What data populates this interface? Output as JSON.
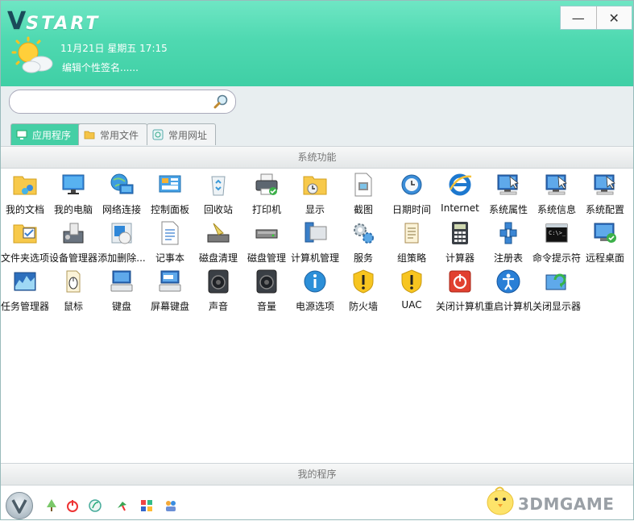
{
  "app": {
    "logo_v": "V",
    "logo_text": "START"
  },
  "window_buttons": {
    "minimize": "—",
    "close": "✕"
  },
  "header": {
    "datetime": "11月21日  星期五  17:15",
    "signature": "编辑个性签名......"
  },
  "search": {
    "value": "",
    "placeholder": ""
  },
  "tabs": [
    {
      "label": "应用程序",
      "icon": "monitor-icon",
      "active": true
    },
    {
      "label": "常用文件",
      "icon": "folder-icon",
      "active": false
    },
    {
      "label": "常用网址",
      "icon": "web-icon",
      "active": false
    }
  ],
  "sections": {
    "system": "系统功能",
    "my_programs": "我的程序"
  },
  "items": [
    {
      "label": "我的文档",
      "icon": "documents-folder-icon"
    },
    {
      "label": "我的电脑",
      "icon": "computer-icon"
    },
    {
      "label": "网络连接",
      "icon": "network-globe-icon"
    },
    {
      "label": "控制面板",
      "icon": "control-panel-icon"
    },
    {
      "label": "回收站",
      "icon": "recycle-bin-icon"
    },
    {
      "label": "打印机",
      "icon": "printer-icon"
    },
    {
      "label": "显示",
      "icon": "display-folder-icon"
    },
    {
      "label": "截图",
      "icon": "screenshot-icon"
    },
    {
      "label": "日期时间",
      "icon": "clock-globe-icon"
    },
    {
      "label": "Internet",
      "icon": "internet-explorer-icon"
    },
    {
      "label": "系统属性",
      "icon": "system-monitor-icon"
    },
    {
      "label": "系统信息",
      "icon": "system-monitor-icon"
    },
    {
      "label": "系统配置",
      "icon": "system-monitor-icon"
    },
    {
      "label": "文件夹选项",
      "icon": "folder-options-icon"
    },
    {
      "label": "设备管理器",
      "icon": "device-manager-icon"
    },
    {
      "label": "添加删除...",
      "icon": "add-remove-icon"
    },
    {
      "label": "记事本",
      "icon": "notepad-icon"
    },
    {
      "label": "磁盘清理",
      "icon": "disk-cleanup-icon"
    },
    {
      "label": "磁盘管理",
      "icon": "disk-icon"
    },
    {
      "label": "计算机管理",
      "icon": "computer-management-icon"
    },
    {
      "label": "服务",
      "icon": "gears-icon"
    },
    {
      "label": "组策略",
      "icon": "scroll-icon"
    },
    {
      "label": "计算器",
      "icon": "calculator-icon"
    },
    {
      "label": "注册表",
      "icon": "registry-cubes-icon"
    },
    {
      "label": "命令提示符",
      "icon": "cmd-icon"
    },
    {
      "label": "远程桌面",
      "icon": "remote-desktop-icon"
    },
    {
      "label": "任务管理器",
      "icon": "task-manager-icon"
    },
    {
      "label": "鼠标",
      "icon": "mouse-icon"
    },
    {
      "label": "键盘",
      "icon": "keyboard-icon"
    },
    {
      "label": "屏幕键盘",
      "icon": "onscreen-keyboard-icon"
    },
    {
      "label": "声音",
      "icon": "speaker-icon"
    },
    {
      "label": "音量",
      "icon": "speaker-icon"
    },
    {
      "label": "电源选项",
      "icon": "power-info-icon"
    },
    {
      "label": "防火墙",
      "icon": "shield-warning-icon"
    },
    {
      "label": "UAC",
      "icon": "shield-warning-icon"
    },
    {
      "label": "关闭计算机",
      "icon": "shutdown-icon"
    },
    {
      "label": "重启计算机",
      "icon": "accessibility-icon"
    },
    {
      "label": "关闭显示器",
      "icon": "display-refresh-icon"
    }
  ],
  "quick_icons": [
    "tree-icon",
    "power-icon",
    "leaf-icon",
    "bird-icon",
    "apps-icon",
    "users-icon"
  ],
  "watermark": {
    "text": "3DMGAME"
  }
}
